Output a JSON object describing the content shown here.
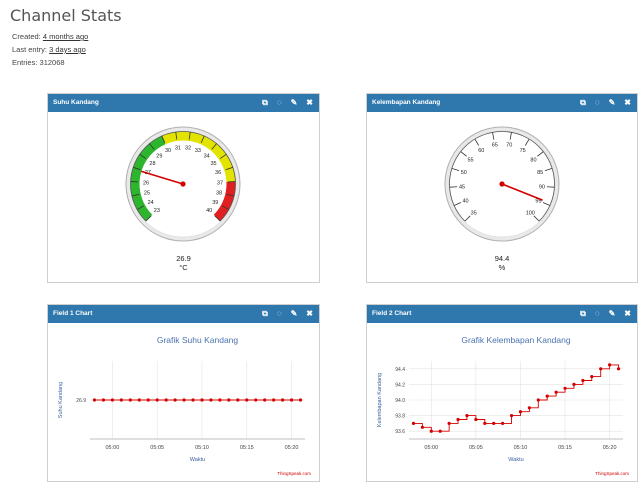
{
  "page": {
    "title": "Channel Stats",
    "created_label": "Created:",
    "created_value": "4 months ago",
    "last_entry_label": "Last entry:",
    "last_entry_value": "3 days ago",
    "entries_label": "Entries:",
    "entries_value": "312068"
  },
  "widgets": {
    "suhu": {
      "title": "Suhu Kandang",
      "value": "26.9",
      "unit": "°C",
      "gauge_min": 23,
      "gauge_max": 40,
      "gauge_ticks": [
        "23",
        "24",
        "25",
        "26",
        "27",
        "28",
        "29",
        "30",
        "31",
        "32",
        "33",
        "34",
        "35",
        "36",
        "37",
        "38",
        "39",
        "40"
      ],
      "gauge_value": 26.9
    },
    "kelembapan": {
      "title": "Kelembapan Kandang",
      "value": "94.4",
      "unit": "%",
      "gauge_min": 35,
      "gauge_max": 100,
      "gauge_ticks": [
        "35",
        "40",
        "45",
        "50",
        "55",
        "60",
        "65",
        "70",
        "75",
        "80",
        "85",
        "90",
        "95",
        "100"
      ],
      "gauge_value": 94.4
    },
    "field1": {
      "title": "Field 1 Chart",
      "credit": "ThingSpeak.com"
    },
    "field2": {
      "title": "Field 2 Chart",
      "credit": "ThingSpeak.com"
    }
  },
  "colors": {
    "header_blue": "#2f78ae",
    "series_red": "#d40000",
    "chart_title": "#4a73b0",
    "gauge_green": "#2db52d",
    "gauge_yellow": "#e3e300",
    "gauge_red": "#e02020"
  },
  "toolbar_icons": [
    "external-link-icon",
    "comment-icon",
    "pencil-icon",
    "close-icon"
  ],
  "chart_data": [
    {
      "type": "line",
      "title": "Grafik Suhu Kandang",
      "xlabel": "Waktu",
      "ylabel": "Suhu Kandang",
      "x_tick_labels": [
        "05:00",
        "05:05",
        "05:10",
        "05:15",
        "05:20"
      ],
      "y_tick_labels": [
        "26.9"
      ],
      "ylim": [
        26.85,
        26.95
      ],
      "series": [
        {
          "x": [
            "04:58",
            "04:59",
            "05:00",
            "05:01",
            "05:02",
            "05:03",
            "05:04",
            "05:05",
            "05:06",
            "05:07",
            "05:08",
            "05:09",
            "05:10",
            "05:11",
            "05:12",
            "05:13",
            "05:14",
            "05:15",
            "05:16",
            "05:17",
            "05:18",
            "05:19",
            "05:20",
            "05:21"
          ],
          "values": [
            26.9,
            26.9,
            26.9,
            26.9,
            26.9,
            26.9,
            26.9,
            26.9,
            26.9,
            26.9,
            26.9,
            26.9,
            26.9,
            26.9,
            26.9,
            26.9,
            26.9,
            26.9,
            26.9,
            26.9,
            26.9,
            26.9,
            26.9,
            26.9
          ]
        }
      ],
      "grid": true
    },
    {
      "type": "line",
      "title": "Grafik Kelembapan Kandang",
      "xlabel": "Waktu",
      "ylabel": "Kelembapan Kandang",
      "x_tick_labels": [
        "05:00",
        "05:05",
        "05:10",
        "05:15",
        "05:20"
      ],
      "y_tick_labels": [
        "93.6",
        "93.8",
        "94.0",
        "94.2",
        "94.4"
      ],
      "ylim": [
        93.5,
        94.5
      ],
      "series": [
        {
          "x": [
            "04:58",
            "04:59",
            "05:00",
            "05:01",
            "05:02",
            "05:03",
            "05:04",
            "05:05",
            "05:06",
            "05:07",
            "05:08",
            "05:09",
            "05:10",
            "05:11",
            "05:12",
            "05:13",
            "05:14",
            "05:15",
            "05:16",
            "05:17",
            "05:18",
            "05:19",
            "05:20",
            "05:21"
          ],
          "values": [
            93.7,
            93.65,
            93.6,
            93.6,
            93.7,
            93.75,
            93.8,
            93.75,
            93.7,
            93.7,
            93.7,
            93.8,
            93.85,
            93.9,
            94.0,
            94.05,
            94.1,
            94.15,
            94.2,
            94.25,
            94.3,
            94.4,
            94.45,
            94.4
          ]
        }
      ],
      "grid": true
    }
  ]
}
